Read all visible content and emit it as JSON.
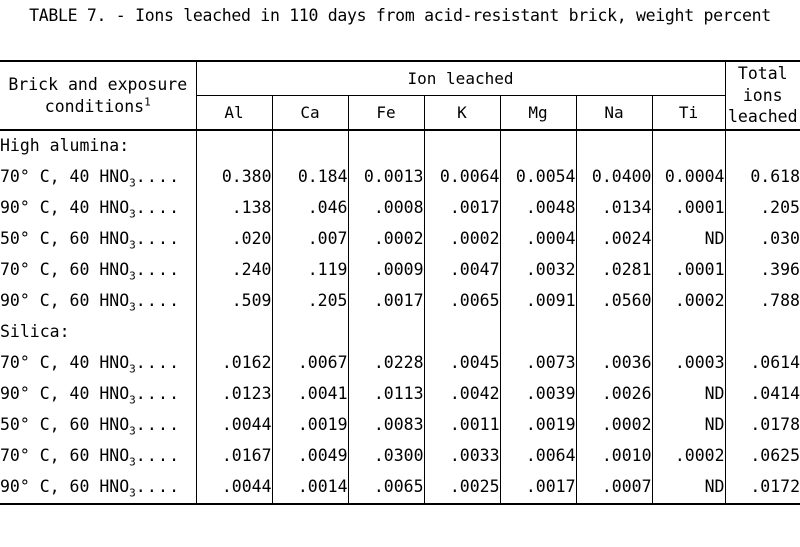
{
  "document": {
    "title": "TABLE 7. - Ions leached in 110 days from acid-resistant brick, weight percent"
  },
  "table": {
    "stub_header_line1": "Brick and exposure",
    "stub_header_line2": "conditions",
    "stub_header_footnote": "1",
    "span_header": "Ion leached",
    "total_header_line1": "Total",
    "total_header_line2": "ions",
    "total_header_line3": "leached",
    "ion_columns": [
      "Al",
      "Ca",
      "Fe",
      "K",
      "Mg",
      "Na",
      "Ti"
    ],
    "groups": [
      {
        "name": "High alumina:",
        "rows": [
          {
            "temp": "70° C, 40 HNO",
            "sub": "3",
            "dots": "....",
            "values": [
              "0.380",
              "0.184",
              "0.0013",
              "0.0064",
              "0.0054",
              "0.0400",
              "0.0004"
            ],
            "total": "0.618"
          },
          {
            "temp": "90° C, 40 HNO",
            "sub": "3",
            "dots": "....",
            "values": [
              ".138",
              ".046",
              ".0008",
              ".0017",
              ".0048",
              ".0134",
              ".0001"
            ],
            "total": ".205"
          },
          {
            "temp": "50° C, 60 HNO",
            "sub": "3",
            "dots": "....",
            "values": [
              ".020",
              ".007",
              ".0002",
              ".0002",
              ".0004",
              ".0024",
              "ND"
            ],
            "total": ".030"
          },
          {
            "temp": "70° C, 60 HNO",
            "sub": "3",
            "dots": "....",
            "values": [
              ".240",
              ".119",
              ".0009",
              ".0047",
              ".0032",
              ".0281",
              ".0001"
            ],
            "total": ".396"
          },
          {
            "temp": "90° C, 60 HNO",
            "sub": "3",
            "dots": "....",
            "values": [
              ".509",
              ".205",
              ".0017",
              ".0065",
              ".0091",
              ".0560",
              ".0002"
            ],
            "total": ".788"
          }
        ]
      },
      {
        "name": "Silica:",
        "rows": [
          {
            "temp": "70° C, 40 HNO",
            "sub": "3",
            "dots": "....",
            "values": [
              ".0162",
              ".0067",
              ".0228",
              ".0045",
              ".0073",
              ".0036",
              ".0003"
            ],
            "total": ".0614"
          },
          {
            "temp": "90° C, 40 HNO",
            "sub": "3",
            "dots": "....",
            "values": [
              ".0123",
              ".0041",
              ".0113",
              ".0042",
              ".0039",
              ".0026",
              "ND"
            ],
            "total": ".0414"
          },
          {
            "temp": "50° C, 60 HNO",
            "sub": "3",
            "dots": "....",
            "values": [
              ".0044",
              ".0019",
              ".0083",
              ".0011",
              ".0019",
              ".0002",
              "ND"
            ],
            "total": ".0178"
          },
          {
            "temp": "70° C, 60 HNO",
            "sub": "3",
            "dots": "....",
            "values": [
              ".0167",
              ".0049",
              ".0300",
              ".0033",
              ".0064",
              ".0010",
              ".0002"
            ],
            "total": ".0625"
          },
          {
            "temp": "90° C, 60 HNO",
            "sub": "3",
            "dots": "....",
            "values": [
              ".0044",
              ".0014",
              ".0065",
              ".0025",
              ".0017",
              ".0007",
              "ND"
            ],
            "total": ".0172"
          }
        ]
      }
    ]
  }
}
